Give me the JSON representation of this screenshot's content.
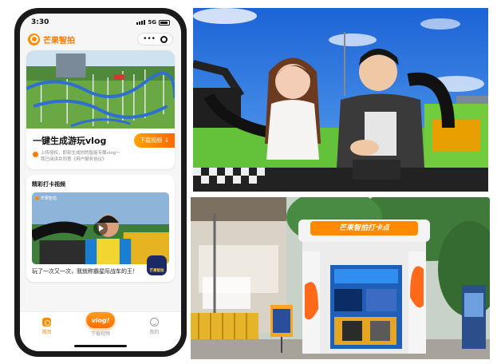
{
  "status_bar": {
    "time": "3:30",
    "network": "5G"
  },
  "header": {
    "app_name": "芒果智拍",
    "more_icon": "ellipsis-icon",
    "close_icon": "target-icon"
  },
  "hero": {
    "title": "一键生成游玩vlog",
    "download_label": "下载视频",
    "consent_line1": "上传授权，即刻生成你的智能专属vlog～",
    "consent_line2": "我已阅读并同意《用户服务协议》"
  },
  "featured": {
    "title": "精彩打卡视频",
    "thumb_badge": "芒果智拍",
    "caption": "玩了一次又一次，我就称霸星际战车的王！",
    "floating_badge": "芒果智拍"
  },
  "tabs": [
    {
      "label": "首页",
      "active": true,
      "icon": "home-icon"
    },
    {
      "label": "下载视频",
      "active": false,
      "icon": "vlog-button",
      "button_text": "vlog!"
    },
    {
      "label": "我的",
      "active": false,
      "icon": "profile-icon"
    }
  ],
  "booth": {
    "sign": "芒果智拍打卡点"
  },
  "colors": {
    "accent": "#ff7a00",
    "accent_light": "#ffa200",
    "sky": "#2f7de8",
    "ride_green": "#6cc43a"
  }
}
